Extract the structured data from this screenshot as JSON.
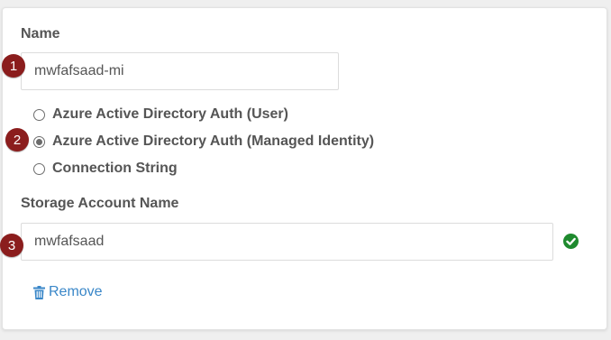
{
  "form": {
    "name_label": "Name",
    "name_value": "mwfafsaad-mi",
    "auth_options": [
      {
        "label": "Azure Active Directory Auth (User)",
        "selected": false
      },
      {
        "label": "Azure Active Directory Auth (Managed Identity)",
        "selected": true
      },
      {
        "label": "Connection String",
        "selected": false
      }
    ],
    "storage_label": "Storage Account Name",
    "storage_value": "mwfafsaad",
    "storage_status_icon": "check-circle-icon",
    "remove_label": "Remove",
    "remove_icon": "trash-icon"
  },
  "annotations": [
    "1",
    "2",
    "3"
  ],
  "colors": {
    "badge": "#8b1d1d",
    "link": "#3a87c8",
    "valid": "#1e8a2e"
  }
}
